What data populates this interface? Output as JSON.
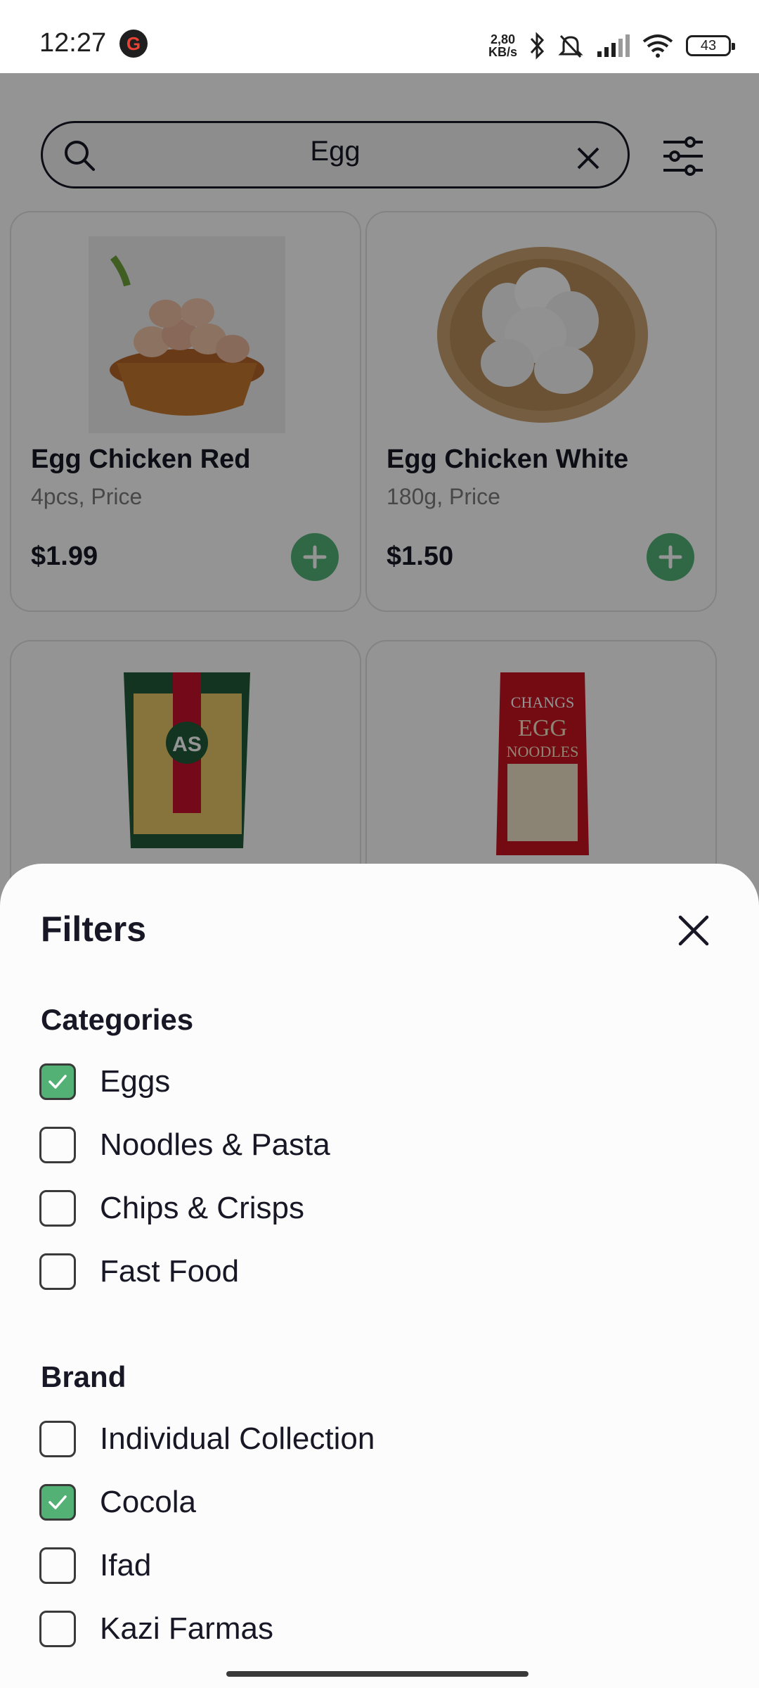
{
  "status_bar": {
    "time": "12:27",
    "google_badge": "G",
    "net_speed_value": "2,80",
    "net_speed_unit": "KB/s",
    "battery": "43"
  },
  "search": {
    "query": "Egg",
    "icons": [
      "search-icon",
      "clear-icon",
      "filter-settings-icon"
    ]
  },
  "products": [
    {
      "name": "Egg Chicken Red",
      "detail": "4pcs, Price",
      "price": "$1.99",
      "image": "egg-basket-brown"
    },
    {
      "name": "Egg Chicken White",
      "detail": "180g, Price",
      "price": "$1.50",
      "image": "egg-basket-white"
    },
    {
      "name": "",
      "detail": "",
      "price": "",
      "image": "pasta-package"
    },
    {
      "name": "",
      "detail": "",
      "price": "",
      "image": "egg-noodles-package"
    }
  ],
  "filters": {
    "title": "Filters",
    "categories_title": "Categories",
    "categories": [
      {
        "label": "Eggs",
        "checked": true
      },
      {
        "label": "Noodles & Pasta",
        "checked": false
      },
      {
        "label": "Chips & Crisps",
        "checked": false
      },
      {
        "label": "Fast Food",
        "checked": false
      }
    ],
    "brand_title": "Brand",
    "brands": [
      {
        "label": "Individual Collection",
        "checked": false
      },
      {
        "label": "Cocola",
        "checked": true
      },
      {
        "label": "Ifad",
        "checked": false
      },
      {
        "label": "Kazi Farmas",
        "checked": false
      }
    ]
  },
  "colors": {
    "accent": "#53b175",
    "text": "#181725",
    "muted": "#7c7c7c"
  }
}
